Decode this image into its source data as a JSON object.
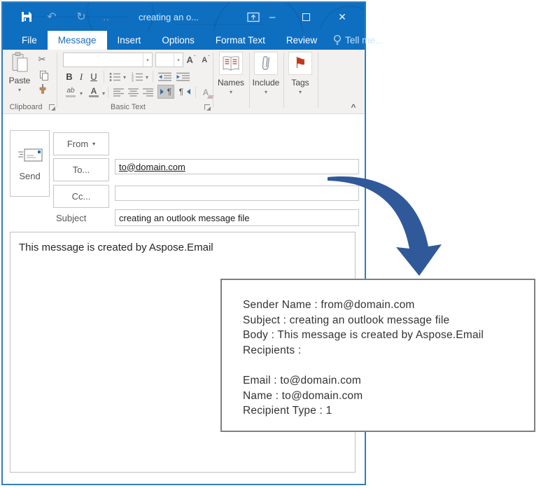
{
  "window": {
    "title": "creating an o..."
  },
  "glyphs": {
    "undo": "↶",
    "redo": "↻",
    "qat_more": "..",
    "minimize": "–",
    "close": "✕",
    "scissors": "✂",
    "dropdown": "▾",
    "pilcrow_ltr": "¶",
    "pilcrow_rtl": "¶",
    "flag": "⚑",
    "collapse": "^",
    "grow_arrow": "ˆ",
    "shrink_arrow": "ˇ"
  },
  "tabs": [
    {
      "label": "File",
      "selected": false
    },
    {
      "label": "Message",
      "selected": true
    },
    {
      "label": "Insert",
      "selected": false
    },
    {
      "label": "Options",
      "selected": false
    },
    {
      "label": "Format Text",
      "selected": false
    },
    {
      "label": "Review",
      "selected": false
    },
    {
      "label": "Tell me...",
      "selected": false
    }
  ],
  "ribbon": {
    "paste_label": "Paste",
    "clipboard_group_label": "Clipboard",
    "basic_text_group_label": "Basic Text",
    "bold": "B",
    "italic": "I",
    "underline": "U",
    "highlight": "ab",
    "font_color": "A",
    "grow_font": "A",
    "shrink_font": "A",
    "clear_format": "A",
    "names_label": "Names",
    "include_label": "Include",
    "tags_label": "Tags"
  },
  "compose": {
    "send_label": "Send",
    "from_label": "From",
    "to_label": "To...",
    "to_value": "to@domain.com",
    "cc_label": "Cc...",
    "cc_value": "",
    "subject_label": "Subject",
    "subject_value": "creating an outlook message file",
    "body_text": "This message is created by Aspose.Email"
  },
  "output": {
    "lines": [
      "Sender Name : from@domain.com",
      "Subject : creating an outlook message file",
      "Body : This message is created by Aspose.Email",
      "Recipients :",
      "",
      "Email : to@domain.com",
      "Name : to@domain.com",
      "Recipient Type : 1"
    ]
  },
  "colors": {
    "titlebar_blue": "#0e6fc1",
    "selected_tab_text": "#1d6ec1",
    "ribbon_bg": "#f2f1f0",
    "window_border": "#2f7dc3",
    "arrow_blue": "#30599a",
    "flag_red": "#c0391b",
    "output_border": "#7f7f7f"
  }
}
